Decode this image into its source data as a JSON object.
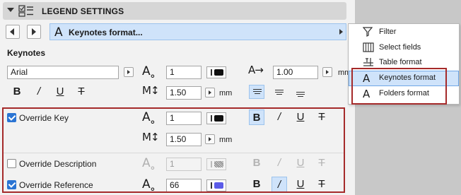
{
  "header": {
    "title": "LEGEND SETTINGS",
    "settings_icon": "legend-settings-icon"
  },
  "nav": {
    "format_label": "Keynotes format...",
    "format_icon": "A"
  },
  "section": {
    "label": "Keynotes"
  },
  "row1": {
    "font": "Arial",
    "pen_value": "1",
    "size_value": "1.00",
    "size_unit": "mm"
  },
  "row2": {
    "spacing_value": "1.50",
    "spacing_unit": "mm"
  },
  "style_glyphs": {
    "bold": "B",
    "italic": "/",
    "underline": "U",
    "strike": "T"
  },
  "override_key": {
    "label": "Override Key",
    "checked": true,
    "pen_value": "1",
    "spacing_value": "1.50",
    "spacing_unit": "mm",
    "bold_active": true
  },
  "override_description": {
    "label": "Override Description",
    "checked": false,
    "pen_value": "1"
  },
  "override_reference": {
    "label": "Override Reference",
    "checked": true,
    "pen_value": "66",
    "pen_color": "#5b5be8",
    "italic_active": true
  },
  "menu": {
    "items": [
      {
        "label": "Filter",
        "icon": "filter-icon"
      },
      {
        "label": "Select fields",
        "icon": "columns-icon"
      },
      {
        "label": "Table format",
        "icon": "table-format-icon"
      },
      {
        "label": "Keynotes format",
        "icon": "A",
        "highlighted": true
      },
      {
        "label": "Folders format",
        "icon": "A"
      }
    ]
  },
  "colors": {
    "accent": "#cfe3fa",
    "highlight_border": "#a52a2a",
    "checkbox": "#2a74d3"
  }
}
